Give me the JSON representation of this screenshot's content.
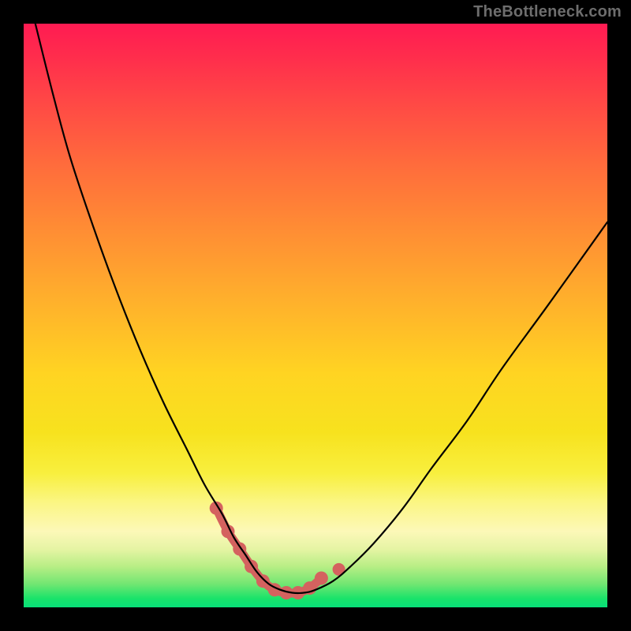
{
  "watermark": "TheBottleneck.com",
  "colors": {
    "background": "#000000",
    "accent": "#d4625f",
    "line": "#000000"
  },
  "chart_data": {
    "type": "line",
    "title": "",
    "xlabel": "",
    "ylabel": "",
    "xlim": [
      0,
      100
    ],
    "ylim": [
      0,
      100
    ],
    "grid": false,
    "legend": false,
    "series": [
      {
        "name": "bottleneck-curve",
        "x": [
          2,
          5,
          8,
          12,
          16,
          20,
          24,
          28,
          31,
          34,
          36,
          38,
          40,
          42,
          44,
          46,
          48,
          50,
          53,
          56,
          60,
          65,
          70,
          76,
          82,
          90,
          100
        ],
        "y": [
          100,
          88,
          77,
          65,
          54,
          44,
          35,
          27,
          21,
          16,
          12,
          9,
          6,
          4,
          3,
          2.5,
          2.5,
          3,
          4.5,
          7,
          11,
          17,
          24,
          32,
          41,
          52,
          66
        ]
      }
    ],
    "accent_segment": {
      "name": "highlight-valley",
      "x": [
        33,
        35,
        37,
        39,
        41,
        43,
        45,
        47,
        49,
        51
      ],
      "y": [
        17,
        13,
        10,
        7,
        4.5,
        3,
        2.5,
        2.5,
        3.3,
        5
      ],
      "end_dot_x": 54,
      "end_dot_y": 6.5
    }
  }
}
